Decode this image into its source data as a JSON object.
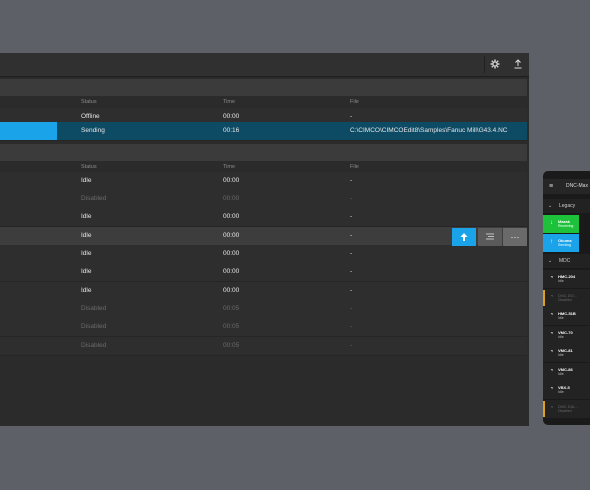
{
  "toolbar": {
    "settings_icon": "gear-icon",
    "upload_icon": "upload-icon"
  },
  "legacy": {
    "columns": {
      "status": "Status",
      "time": "Time",
      "file": "File"
    },
    "rows": [
      {
        "status": "Offline",
        "time": "00:00",
        "file": "-",
        "state": "normal"
      },
      {
        "status": "Sending",
        "time": "00:16",
        "file": "C:\\CIMCO\\CIMCOEdit8\\Samples\\Fanuc Mill\\G43.4.NC",
        "state": "sending"
      }
    ]
  },
  "mdc": {
    "columns": {
      "status": "Status",
      "time": "Time",
      "file": "File"
    },
    "rows": [
      {
        "status": "Idle",
        "time": "00:00",
        "file": "-",
        "state": "normal"
      },
      {
        "status": "Disabled",
        "time": "00:00",
        "file": "-",
        "state": "disabled"
      },
      {
        "status": "Idle",
        "time": "00:00",
        "file": "-",
        "state": "normal"
      },
      {
        "status": "Idle",
        "time": "00:00",
        "file": "-",
        "state": "hover"
      },
      {
        "status": "Idle",
        "time": "00:00",
        "file": "-",
        "state": "normal"
      },
      {
        "status": "Idle",
        "time": "00:00",
        "file": "-",
        "state": "normal"
      },
      {
        "status": "Idle",
        "time": "00:00",
        "file": "-",
        "state": "normal"
      },
      {
        "status": "Disabled",
        "time": "00:05",
        "file": "-",
        "state": "disabled"
      },
      {
        "status": "Disabled",
        "time": "00:05",
        "file": "-",
        "state": "disabled"
      },
      {
        "status": "Disabled",
        "time": "00:05",
        "file": "-",
        "state": "disabled"
      }
    ]
  },
  "row_actions": {
    "send_icon": "upload-arrow-icon",
    "list_icon": "list-icon",
    "more_label": "···"
  },
  "phone": {
    "menu_icon": "≡",
    "title": "DNC-Max",
    "legacy_group": "Legacy",
    "mdc_group": "MDC",
    "legacy_items": [
      {
        "name": "Mazak",
        "status": "Receiving",
        "color": "#1ec23a"
      },
      {
        "name": "Okuma",
        "status": "Sending",
        "color": "#1aa3e8"
      }
    ],
    "mdc_items": [
      {
        "name": "HMC-204",
        "status": "Idle",
        "disabled": false
      },
      {
        "name": "DNC DO...",
        "status": "Disabled",
        "disabled": true
      },
      {
        "name": "HMC-51B",
        "status": "Idle",
        "disabled": false
      },
      {
        "name": "VMC-70",
        "status": "Idle",
        "disabled": false
      },
      {
        "name": "VMC-81",
        "status": "Idle",
        "disabled": false
      },
      {
        "name": "VMC-86",
        "status": "Idle",
        "disabled": false
      },
      {
        "name": "VBX-5",
        "status": "Idle",
        "disabled": false
      },
      {
        "name": "DNC DIA...",
        "status": "Disabled",
        "disabled": true
      }
    ]
  }
}
